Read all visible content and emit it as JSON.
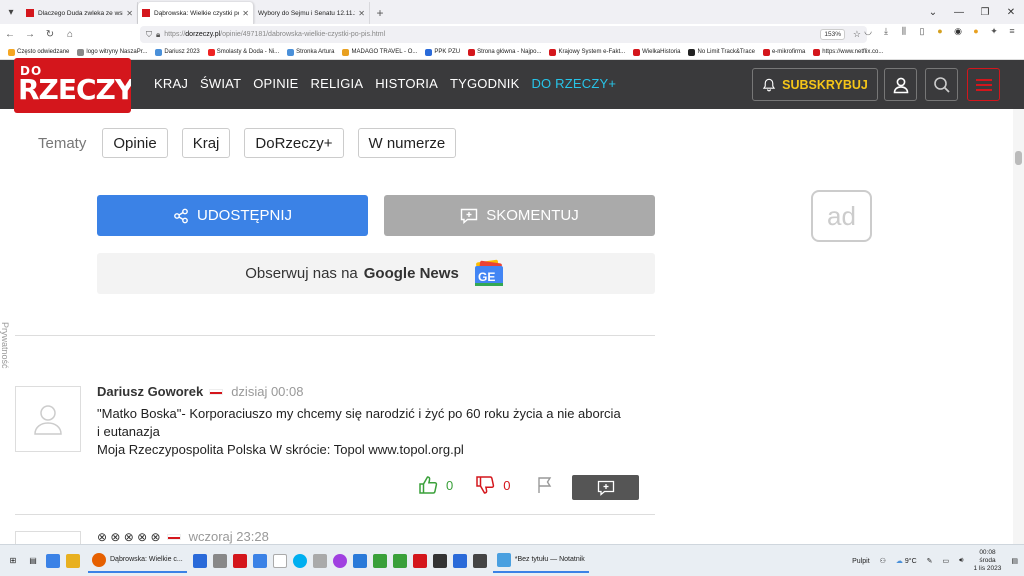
{
  "browser": {
    "tabs": [
      {
        "title": "Dlaczego Duda zwleka ze wskaz",
        "active": false
      },
      {
        "title": "Dąbrowska: Wielkie czystki po 1",
        "active": true
      },
      {
        "title": "Wybory do Sejmu i Senatu 12.11.20",
        "active": false
      }
    ],
    "url_prefix": "https://",
    "url_host": "dorzeczy.pl",
    "url_path": "/opinie/497181/dabrowska-wielkie-czystki-po-pis.html",
    "zoom": "153%"
  },
  "bookmarks": [
    {
      "label": "Często odwiedzane",
      "color": "#f5a623"
    },
    {
      "label": "logo witryny NaszaPr...",
      "color": "#888"
    },
    {
      "label": "Dariusz 2023",
      "color": "#4a90d9"
    },
    {
      "label": "Smolasty & Doda - Ni...",
      "color": "#e22"
    },
    {
      "label": "Stronka Artura",
      "color": "#4a90d9"
    },
    {
      "label": "MADAGO TRAVEL - O...",
      "color": "#e8a020"
    },
    {
      "label": "PPK PZU",
      "color": "#2a6ad9"
    },
    {
      "label": "Strona główna - Najpo...",
      "color": "#d4161c"
    },
    {
      "label": "Krajowy System e-Fakt...",
      "color": "#d4161c"
    },
    {
      "label": "WielkaHistoria",
      "color": "#d4161c"
    },
    {
      "label": "No Limit Track&Trace",
      "color": "#222"
    },
    {
      "label": "e-mikrofirma",
      "color": "#d4161c"
    },
    {
      "label": "https://www.netflix.co...",
      "color": "#d4161c"
    }
  ],
  "site": {
    "logo_top": "DO",
    "logo_main": "RZECZY",
    "nav": [
      "KRAJ",
      "ŚWIAT",
      "OPINIE",
      "RELIGIA",
      "HISTORIA",
      "TYGODNIK"
    ],
    "nav_plus": "DO RZECZY+",
    "subscribe": "SUBSKRYBUJ"
  },
  "topics": {
    "label": "Tematy",
    "items": [
      "Opinie",
      "Kraj",
      "DoRzeczy+",
      "W numerze"
    ]
  },
  "actions": {
    "share": "UDOSTĘPNIJ",
    "comment": "SKOMENTUJ",
    "gnews_prefix": "Obserwuj nas na",
    "gnews_bold": "Google News"
  },
  "ad_label": "ad",
  "privacy_label": "Prywatność",
  "comments": [
    {
      "author": "Dariusz Goworek",
      "time": "dzisiaj 00:08",
      "text_lines": [
        "\"Matko Boska\"- Korporaciuszo my chcemy się narodzić i żyć po 60 roku życia a nie aborcia",
        "i eutanazja",
        "Moja Rzeczypospolita Polska W skrócie: Topol www.topol.org.pl"
      ],
      "likes": "0",
      "dislikes": "0"
    },
    {
      "author": "⊗ ⊗ ⊗ ⊗ ⊗",
      "time": "wczoraj 23:28"
    }
  ],
  "taskbar": {
    "active_app": "Dąbrowska: Wielkie c...",
    "notepad": "*Bez tytułu — Notatnik",
    "desktop": "Pulpit",
    "weather": "9°C",
    "time": "00:08",
    "day": "środa",
    "date": "1 lis 2023"
  }
}
